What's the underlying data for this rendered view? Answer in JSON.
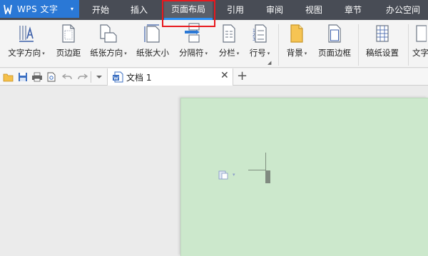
{
  "app": {
    "name": "WPS 文字",
    "menu_caret": "▾"
  },
  "menu_tabs": [
    {
      "label": "开始"
    },
    {
      "label": "插入"
    },
    {
      "label": "页面布局",
      "active": true
    },
    {
      "label": "引用"
    },
    {
      "label": "审阅"
    },
    {
      "label": "视图"
    },
    {
      "label": "章节"
    },
    {
      "label": "办公空间"
    }
  ],
  "ribbon": {
    "text_direction": "文字方向",
    "margins": "页边距",
    "orientation": "纸张方向",
    "paper_size": "纸张大小",
    "breaks": "分隔符",
    "columns": "分栏",
    "line_numbers": "行号",
    "background": "背景",
    "page_border": "页面边框",
    "manuscript": "稿纸设置",
    "text_more": "文字"
  },
  "document": {
    "tab_title": "文档 1",
    "close_symbol": "✕",
    "new_tab_symbol": "+"
  },
  "colors": {
    "menubar": "#484c55",
    "app_button": "#2a78d6",
    "active_tab_underline": "#2c8ef2",
    "highlight_box": "#e8191e",
    "page_background": "#cce8cc",
    "workspace": "#ebebeb"
  }
}
